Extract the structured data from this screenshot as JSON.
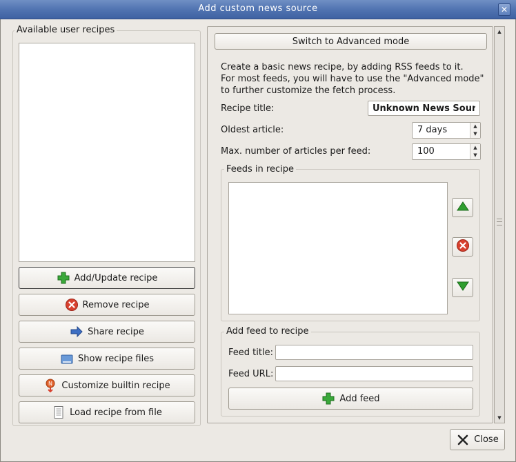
{
  "window": {
    "title": "Add custom news source",
    "close_glyph": "✕"
  },
  "left": {
    "group_label": "Available user recipes",
    "buttons": {
      "add_update": "Add/Update recipe",
      "remove": "Remove recipe",
      "share": "Share recipe",
      "show_files": "Show recipe files",
      "customize_builtin": "Customize builtin recipe",
      "load_from_file": "Load recipe from file"
    }
  },
  "right": {
    "switch_button": "Switch to Advanced mode",
    "description": [
      "Create a basic news recipe, by adding RSS feeds to it.",
      "For most feeds, you will have to use the \"Advanced mode\"",
      "to further customize the fetch process."
    ],
    "recipe_title": {
      "label": "Recipe title:",
      "value": "Unknown News Source"
    },
    "oldest_article": {
      "label": "Oldest article:",
      "value": "7 days"
    },
    "max_articles": {
      "label": "Max. number of articles per feed:",
      "value": "100"
    },
    "feeds_group_label": "Feeds in recipe",
    "add_feed_group": {
      "label": "Add feed to recipe",
      "feed_title_label": "Feed title:",
      "feed_title_value": "",
      "feed_url_label": "Feed URL:",
      "feed_url_value": "",
      "add_button": "Add feed"
    }
  },
  "footer": {
    "close_button": "Close"
  },
  "icons": {
    "add": "plus-icon",
    "remove": "remove-icon",
    "share": "arrow-right-icon",
    "show_files": "folder-icon",
    "customize": "news-marker-icon",
    "load": "document-icon",
    "move_up": "arrow-up-icon",
    "move_down": "arrow-down-icon",
    "close": "close-x-icon"
  },
  "colors": {
    "titlebar": "#4f72b0",
    "add_green": "#2f9e2f",
    "remove_red": "#d23a2a",
    "share_blue": "#3a6cc0"
  }
}
